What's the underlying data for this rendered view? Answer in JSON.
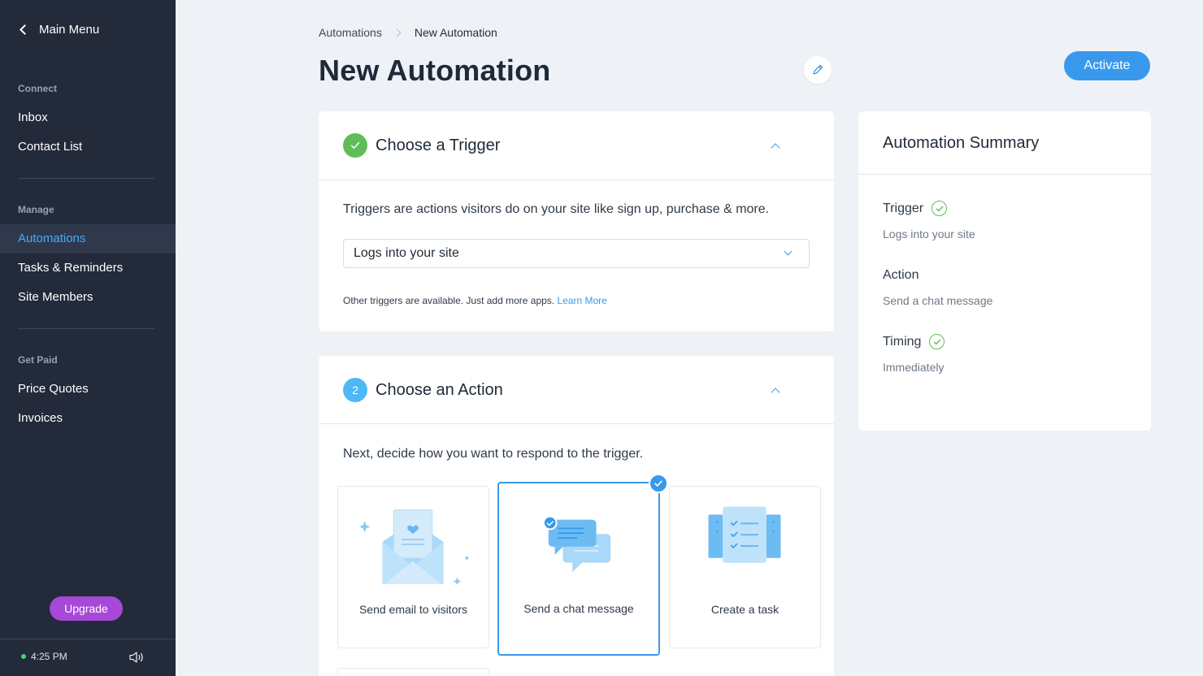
{
  "sidebar": {
    "back_label": "Main Menu",
    "sections": [
      {
        "label": "Connect",
        "items": [
          "Inbox",
          "Contact List"
        ]
      },
      {
        "label": "Manage",
        "items": [
          "Automations",
          "Tasks & Reminders",
          "Site Members"
        ]
      },
      {
        "label": "Get Paid",
        "items": [
          "Price Quotes",
          "Invoices"
        ]
      }
    ],
    "active_item": "Automations",
    "upgrade_label": "Upgrade",
    "time": "4:25 PM",
    "sound_icon": "speaker-icon"
  },
  "header": {
    "breadcrumb": [
      "Automations",
      "New Automation"
    ],
    "title": "New Automation",
    "edit_icon": "pencil-icon",
    "activate_label": "Activate"
  },
  "trigger": {
    "title": "Choose a Trigger",
    "status_icon": "check-icon",
    "description": "Triggers are actions visitors do on your site like sign up, purchase & more.",
    "selected": "Logs into your site",
    "note": "Other triggers are available. Just add more apps.",
    "learn_more": "Learn More"
  },
  "action": {
    "step_number": "2",
    "title": "Choose an Action",
    "description": "Next, decide how you want to respond to the trigger.",
    "options": [
      {
        "label": "Send email to visitors",
        "icon": "email-envelope-icon"
      },
      {
        "label": "Send a chat message",
        "icon": "chat-bubbles-icon",
        "selected": true
      },
      {
        "label": "Create a task",
        "icon": "task-checklist-icon"
      }
    ]
  },
  "summary": {
    "title": "Automation Summary",
    "rows": [
      {
        "label": "Trigger",
        "value": "Logs into your site",
        "complete": true
      },
      {
        "label": "Action",
        "value": "Send a chat message",
        "complete": false
      },
      {
        "label": "Timing",
        "value": "Immediately",
        "complete": true
      }
    ]
  },
  "colors": {
    "sidebar_bg": "#232a3a",
    "accent": "#3899ec",
    "success": "#60bc57",
    "upgrade": "#a748d8",
    "page_bg": "#eef1f6"
  }
}
